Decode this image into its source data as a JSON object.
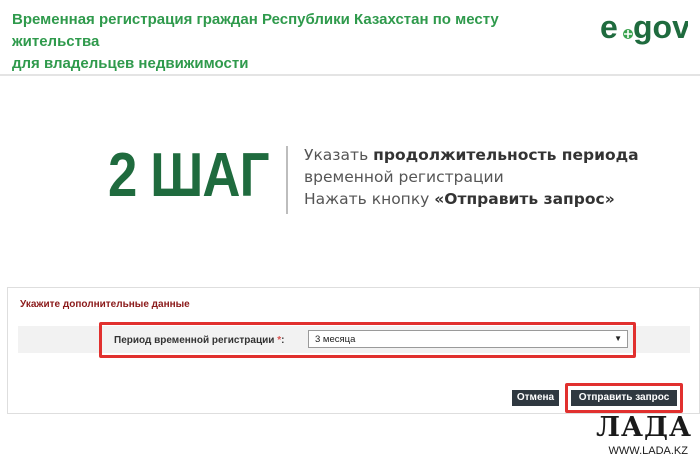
{
  "header": {
    "title_line1": "Временная регистрация граждан Республики Казахстан по месту жительства",
    "title_line2": "для владельцев недвижимости",
    "logo_text": "egov",
    "colors": {
      "title": "#2f9a4c",
      "logo": "#1f6b3e"
    }
  },
  "step": {
    "number": "2 ШАГ",
    "line1_prefix": "Указать ",
    "line1_bold": "продолжительность периода",
    "line2": "временной регистрации",
    "line3_prefix": "Нажать  кнопку ",
    "line3_bold": "«Отправить запрос»"
  },
  "form": {
    "section_title": "Укажите дополнительные данные",
    "field_label": "Период временной регистрации",
    "required_mark": "*",
    "label_suffix": ":",
    "selected_value": "3 месяца",
    "dropdown_icon": "chevron-down-icon"
  },
  "buttons": {
    "cancel": "Отмена",
    "submit": "Отправить запрос",
    "highlight_color": "#e1302e"
  },
  "watermark": {
    "name": "ЛАДА",
    "url": "WWW.LADA.KZ"
  }
}
